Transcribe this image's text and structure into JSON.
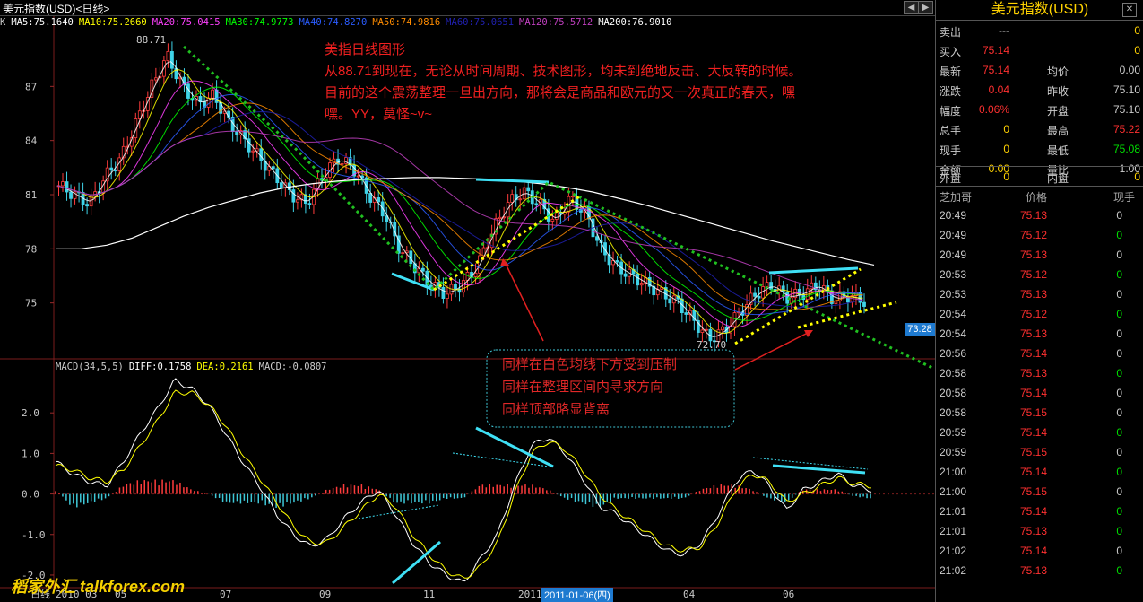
{
  "window": {
    "title": "美元指数(USD)<日线>"
  },
  "ma_legend": [
    {
      "label": "K",
      "color": "#cccccc"
    },
    {
      "label": "MA5:75.1640",
      "color": "#ffffff"
    },
    {
      "label": "MA10:75.2660",
      "color": "#ffff00"
    },
    {
      "label": "MA20:75.0415",
      "color": "#ff40ff"
    },
    {
      "label": "MA30:74.9773",
      "color": "#00ff00"
    },
    {
      "label": "MA40:74.8270",
      "color": "#2a5cff"
    },
    {
      "label": "MA50:74.9816",
      "color": "#ff8c00"
    },
    {
      "label": "MA60:75.0651",
      "color": "#2020b0"
    },
    {
      "label": "MA120:75.5712",
      "color": "#c040c0"
    },
    {
      "label": "MA200:76.9010",
      "color": "#ffffff"
    }
  ],
  "macd_legend": [
    {
      "label": "MACD(34,5,5)",
      "color": "#cccccc"
    },
    {
      "label": "DIFF:0.1758",
      "color": "#ffffff"
    },
    {
      "label": "DEA:0.2161",
      "color": "#ffff00"
    },
    {
      "label": "MACD:-0.0807",
      "color": "#cccccc"
    }
  ],
  "annotation_lines": [
    "美指日线图形",
    "从88.71到现在，无论从时间周期、技术图形，均未到绝地反击、大反转的时候。",
    "目前的这个震荡整理一旦出方向，那将会是商品和欧元的又一次真正的春天，嘿",
    "嘿。YY，莫怪~v~"
  ],
  "box_lines": [
    "同样在白色均线下方受到压制",
    "同样在整理区间内寻求方向",
    "同样顶部略显背离"
  ],
  "price_tag": "73.28",
  "high_label": "88.71",
  "low_label": "72.70",
  "date_tag": "2011-01-06(四)",
  "watermark": "稻家外汇 talkforex.com",
  "chart_data": [
    {
      "type": "candlestick",
      "title": "美元指数(USD)<日线>",
      "ylim": [
        72,
        90
      ],
      "yticks": [
        87,
        84,
        81,
        78,
        75
      ],
      "x_ticks": [
        "日线",
        "2010 03",
        "05",
        "07",
        "09",
        "11",
        "2011",
        "04",
        "06"
      ],
      "close": [
        81.5,
        81.0,
        80.5,
        82,
        83,
        85,
        87,
        88.7,
        87,
        86,
        86.5,
        85,
        84,
        83,
        82,
        81,
        80.5,
        82,
        83,
        82.5,
        81,
        80,
        78,
        77,
        76,
        75.5,
        76,
        77,
        79,
        80.5,
        81.2,
        80.5,
        79.5,
        80.8,
        80,
        78,
        77,
        76.5,
        76,
        75.5,
        75,
        74,
        73,
        73.5,
        74.5,
        75.5,
        76,
        75.3,
        75.5,
        76,
        75.2,
        75.4,
        75.1
      ],
      "ma200": [
        78,
        78,
        78.2,
        78.6,
        79.2,
        79.8,
        80.3,
        80.7,
        81.1,
        81.4,
        81.6,
        81.75,
        81.85,
        81.9,
        81.95,
        81.95,
        81.9,
        81.85,
        81.75,
        81.6,
        81.4,
        81.15,
        80.8,
        80.45,
        80.05,
        79.65,
        79.25,
        78.85,
        78.45,
        78.1,
        77.75,
        77.4,
        77.1
      ],
      "series": [
        {
          "name": "MA5",
          "last": 75.164
        },
        {
          "name": "MA10",
          "last": 75.266
        },
        {
          "name": "MA20",
          "last": 75.0415
        },
        {
          "name": "MA30",
          "last": 74.9773
        },
        {
          "name": "MA40",
          "last": 74.827
        },
        {
          "name": "MA50",
          "last": 74.9816
        },
        {
          "name": "MA60",
          "last": 75.0651
        },
        {
          "name": "MA120",
          "last": 75.5712
        },
        {
          "name": "MA200",
          "last": 76.901
        }
      ]
    },
    {
      "type": "macd",
      "title": "MACD(34,5,5)",
      "ylim": [
        -2.2,
        3.0
      ],
      "yticks": [
        2.0,
        1.0,
        0,
        -1.0,
        -2.0
      ],
      "diff": [
        0.8,
        0.5,
        0.3,
        0.2,
        0.8,
        1.5,
        2.1,
        2.8,
        2.6,
        2.2,
        1.5,
        0.8,
        0.2,
        -0.5,
        -1.0,
        -1.3,
        -1.1,
        -0.6,
        -0.2,
        0.1,
        -0.5,
        -1.2,
        -1.7,
        -2.0,
        -2.2,
        -1.6,
        -1.0,
        0.2,
        1.2,
        1.4,
        1.0,
        0.4,
        -0.3,
        -0.5,
        -0.8,
        -1.1,
        -1.4,
        -1.5,
        -1.2,
        -0.5,
        0.3,
        0.6,
        0.2,
        -0.4,
        0.1,
        0.3,
        0.5,
        0.2,
        0.1
      ],
      "dea": [
        0.7,
        0.6,
        0.4,
        0.3,
        0.6,
        1.2,
        1.8,
        2.5,
        2.5,
        2.2,
        1.7,
        1.0,
        0.4,
        -0.2,
        -0.8,
        -1.2,
        -1.2,
        -0.8,
        -0.4,
        0.0,
        -0.3,
        -1.0,
        -1.5,
        -1.9,
        -2.1,
        -1.8,
        -1.2,
        0.0,
        1.0,
        1.3,
        1.1,
        0.6,
        0.0,
        -0.4,
        -0.7,
        -1.0,
        -1.3,
        -1.4,
        -1.3,
        -0.7,
        0.1,
        0.5,
        0.3,
        -0.2,
        0.0,
        0.2,
        0.4,
        0.25,
        0.2
      ],
      "histogram": [
        0.1,
        -0.3,
        -0.2,
        -0.1,
        0.2,
        0.3,
        0.3,
        0.3,
        0.1,
        0,
        -0.2,
        -0.2,
        -0.2,
        -0.3,
        -0.2,
        -0.1,
        0.1,
        0.2,
        0.2,
        0.1,
        -0.2,
        -0.2,
        -0.2,
        -0.1,
        -0.1,
        0.2,
        0.2,
        0.2,
        0.2,
        0.1,
        -0.1,
        -0.2,
        -0.3,
        -0.1,
        -0.1,
        -0.1,
        -0.1,
        -0.1,
        0.1,
        0.2,
        0.2,
        0.1,
        -0.1,
        -0.2,
        0.1,
        0.1,
        0.1,
        -0.05,
        -0.1
      ]
    }
  ],
  "panel": {
    "title": "美元指数(USD)",
    "quote_rows": [
      {
        "l1": "卖出",
        "v1": "---",
        "v1c": "#cccccc",
        "v2": "0",
        "v2c": "#ffd200"
      },
      {
        "l1": "买入",
        "v1": "75.14",
        "v1c": "#ff3030",
        "v2": "0",
        "v2c": "#ffd200"
      },
      {
        "l1": "最新",
        "v1": "75.14",
        "v1c": "#ff3030",
        "l2": "均价",
        "v2": "0.00",
        "v2c": "#cccccc"
      },
      {
        "l1": "涨跌",
        "v1": "0.04",
        "v1c": "#ff3030",
        "l2": "昨收",
        "v2": "75.10",
        "v2c": "#cccccc"
      },
      {
        "l1": "幅度",
        "v1": "0.06%",
        "v1c": "#ff3030",
        "l2": "开盘",
        "v2": "75.10",
        "v2c": "#cccccc"
      },
      {
        "l1": "总手",
        "v1": "0",
        "v1c": "#ffd200",
        "l2": "最高",
        "v2": "75.22",
        "v2c": "#ff3030"
      },
      {
        "l1": "现手",
        "v1": "0",
        "v1c": "#ffd200",
        "l2": "最低",
        "v2": "75.08",
        "v2c": "#00e000"
      },
      {
        "l1": "金额",
        "v1": "0.00",
        "v1c": "#ffd200",
        "l2": "量比",
        "v2": "1.00",
        "v2c": "#cccccc"
      }
    ],
    "outer_label": "外盘",
    "outer_value": "0",
    "inner_label": "内盘",
    "inner_value": "0",
    "tick_headers": [
      "芝加哥",
      "价格",
      "现手"
    ],
    "ticks": [
      {
        "time": "20:49",
        "price": "75.13",
        "vol": "0",
        "vc": "#cccccc"
      },
      {
        "time": "20:49",
        "price": "75.12",
        "vol": "0",
        "vc": "#00e000"
      },
      {
        "time": "20:49",
        "price": "75.13",
        "vol": "0",
        "vc": "#cccccc"
      },
      {
        "time": "20:53",
        "price": "75.12",
        "vol": "0",
        "vc": "#00e000"
      },
      {
        "time": "20:53",
        "price": "75.13",
        "vol": "0",
        "vc": "#cccccc"
      },
      {
        "time": "20:54",
        "price": "75.12",
        "vol": "0",
        "vc": "#00e000"
      },
      {
        "time": "20:54",
        "price": "75.13",
        "vol": "0",
        "vc": "#cccccc"
      },
      {
        "time": "20:56",
        "price": "75.14",
        "vol": "0",
        "vc": "#cccccc"
      },
      {
        "time": "20:58",
        "price": "75.13",
        "vol": "0",
        "vc": "#00e000"
      },
      {
        "time": "20:58",
        "price": "75.14",
        "vol": "0",
        "vc": "#cccccc"
      },
      {
        "time": "20:58",
        "price": "75.15",
        "vol": "0",
        "vc": "#cccccc"
      },
      {
        "time": "20:59",
        "price": "75.14",
        "vol": "0",
        "vc": "#00e000"
      },
      {
        "time": "20:59",
        "price": "75.15",
        "vol": "0",
        "vc": "#cccccc"
      },
      {
        "time": "21:00",
        "price": "75.14",
        "vol": "0",
        "vc": "#00e000"
      },
      {
        "time": "21:00",
        "price": "75.15",
        "vol": "0",
        "vc": "#cccccc"
      },
      {
        "time": "21:01",
        "price": "75.14",
        "vol": "0",
        "vc": "#00e000"
      },
      {
        "time": "21:01",
        "price": "75.13",
        "vol": "0",
        "vc": "#00e000"
      },
      {
        "time": "21:02",
        "price": "75.14",
        "vol": "0",
        "vc": "#cccccc"
      },
      {
        "time": "21:02",
        "price": "75.13",
        "vol": "0",
        "vc": "#00e000"
      }
    ]
  }
}
